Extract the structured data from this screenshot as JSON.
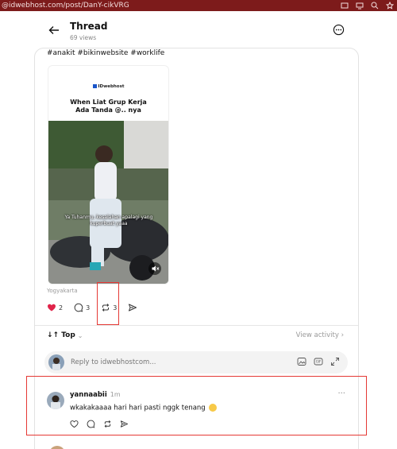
{
  "browser": {
    "url": "@idwebhost.com/post/DanY-cikVRG"
  },
  "header": {
    "title": "Thread",
    "views": "69 views"
  },
  "post": {
    "hashtags": "#anakit #bikinwebsite #worklife",
    "media": {
      "logo": "IDwebhost",
      "title_line1": "When Liat Grup Kerja",
      "title_line2": "Ada Tanda @.. nya",
      "caption": "Ya Tuhanmu, kesalahan apalagi yang kuperbuat yaaa"
    },
    "location": "Yogyakarta",
    "like_count": "2",
    "comment_count": "3",
    "repost_count": "3"
  },
  "replies": {
    "sort_label": "Top",
    "view_activity": "View activity",
    "reply_placeholder": "Reply to idwebhostcom..."
  },
  "comment": {
    "author": "yannaabii",
    "time": "1m",
    "text": "wkakakaaaa hari hari pasti nggk tenang"
  },
  "colors": {
    "browser_bar": "#7d1b1b",
    "like_red": "#e0244a",
    "highlight_red": "#e53935",
    "brand_blue": "#1a55c9"
  },
  "icons": [
    "back-arrow-icon",
    "more-icon",
    "heart-icon",
    "comment-icon",
    "repost-icon",
    "share-icon",
    "mute-icon",
    "image-icon",
    "gif-icon",
    "expand-icon"
  ]
}
